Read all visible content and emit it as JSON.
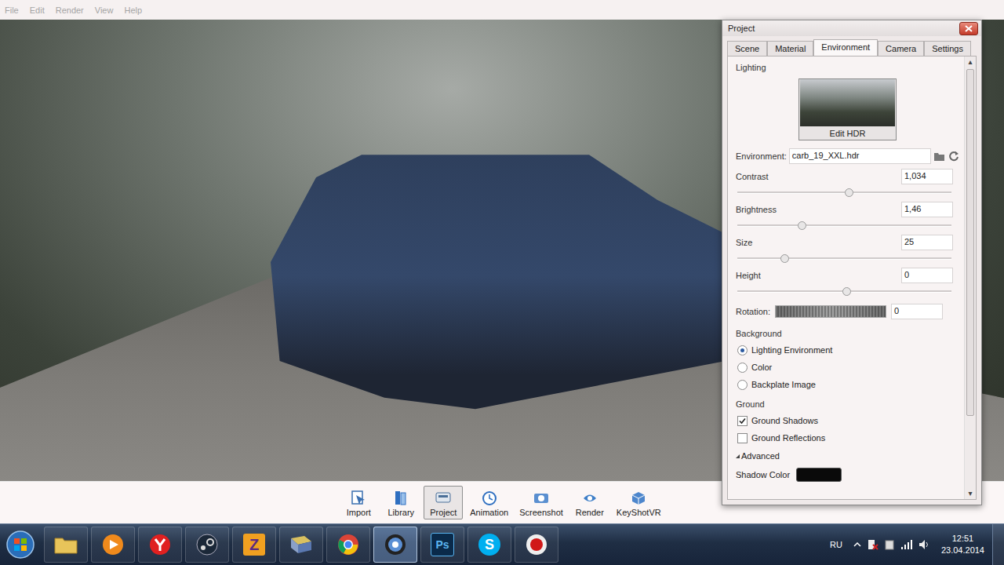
{
  "menu": [
    "File",
    "Edit",
    "Render",
    "View",
    "Help"
  ],
  "panel": {
    "title": "Project",
    "tabs": [
      {
        "label": "Scene",
        "selected": false
      },
      {
        "label": "Material",
        "selected": false
      },
      {
        "label": "Environment",
        "selected": true
      },
      {
        "label": "Camera",
        "selected": false
      },
      {
        "label": "Settings",
        "selected": false
      }
    ],
    "lighting": {
      "title": "Lighting",
      "thumb_label": "Edit HDR",
      "environment_label": "Environment:",
      "environment_value": "carb_19_XXL.hdr"
    },
    "sliders": [
      {
        "label": "Contrast",
        "value": "1,034",
        "level": 0.52,
        "kind": "slider"
      },
      {
        "label": "Brightness",
        "value": "1,46",
        "level": 0.3,
        "kind": "slider"
      },
      {
        "label": "Size",
        "value": "25",
        "level": 0.22,
        "kind": "slider"
      },
      {
        "label": "Height",
        "value": "0",
        "level": 0.51,
        "kind": "slider"
      },
      {
        "label": "Rotation:",
        "value": "0",
        "kind": "gradient"
      }
    ],
    "background": {
      "title": "Background",
      "options": [
        {
          "label": "Lighting Environment",
          "selected": true
        },
        {
          "label": "Color",
          "selected": false
        },
        {
          "label": "Backplate Image",
          "selected": false
        }
      ]
    },
    "ground": {
      "title": "Ground",
      "options": [
        {
          "label": "Ground Shadows",
          "checked": true
        },
        {
          "label": "Ground Reflections",
          "checked": false
        }
      ]
    },
    "advanced": {
      "label": "Advanced",
      "expanded": true
    },
    "shadow_color": {
      "label": "Shadow Color",
      "color": "#0a0a0a"
    }
  },
  "toolbar": [
    {
      "label": "Import",
      "selected": false
    },
    {
      "label": "Library",
      "selected": false
    },
    {
      "label": "Project",
      "selected": true
    },
    {
      "label": "Animation",
      "selected": false
    },
    {
      "label": "Screenshot",
      "selected": false
    },
    {
      "label": "Render",
      "selected": false
    },
    {
      "label": "KeyShotVR",
      "selected": false
    }
  ],
  "taskbar": {
    "apps": [
      {
        "kind": "folder",
        "active": false
      },
      {
        "kind": "media",
        "active": false
      },
      {
        "kind": "yandex",
        "active": false
      },
      {
        "kind": "steam",
        "active": false
      },
      {
        "kind": "letter",
        "glyph": "Z",
        "active": false
      },
      {
        "kind": "archive",
        "active": false
      },
      {
        "kind": "chrome",
        "active": false
      },
      {
        "kind": "keyshot",
        "active": true
      },
      {
        "kind": "letter-blue",
        "glyph": "Ps",
        "active": false
      },
      {
        "kind": "skype",
        "glyph": "S",
        "active": false
      },
      {
        "kind": "recorder",
        "active": false
      }
    ],
    "language": "RU",
    "time": "12:51",
    "date": "23.04.2014"
  }
}
